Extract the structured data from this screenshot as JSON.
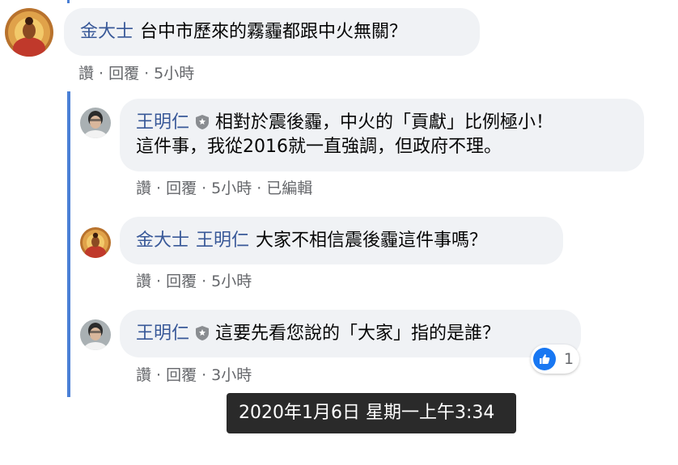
{
  "comments": [
    {
      "author": "金大士",
      "text": "台中市歷來的霧霾都跟中火無關？",
      "actions": {
        "like": "讚",
        "reply": "回覆",
        "time": "5小時"
      }
    },
    {
      "author": "王明仁",
      "text_line1": "相對於震後霾，中火的「貢獻」比例極小！",
      "text_line2": "這件事，我從2016就一直強調，但政府不理。",
      "actions": {
        "like": "讚",
        "reply": "回覆",
        "time": "5小時",
        "edited": "已編輯"
      }
    },
    {
      "author": "金大士",
      "mention": "王明仁",
      "text": "大家不相信震後霾這件事嗎？",
      "actions": {
        "like": "讚",
        "reply": "回覆",
        "time": "5小時"
      }
    },
    {
      "author": "王明仁",
      "text": "這要先看您說的「大家」指的是誰？",
      "actions": {
        "like": "讚",
        "reply": "回覆",
        "time": "3小時"
      },
      "reaction": {
        "icon": "thumbs-up-icon",
        "count": "1"
      }
    }
  ],
  "separator": "·",
  "tooltip": {
    "text": "2020年1月6日 星期一上午3:34"
  },
  "colors": {
    "author": "#385898",
    "thread_line": "#4a80d6",
    "bubble": "#f0f2f5",
    "like_blue": "#1877f2"
  }
}
